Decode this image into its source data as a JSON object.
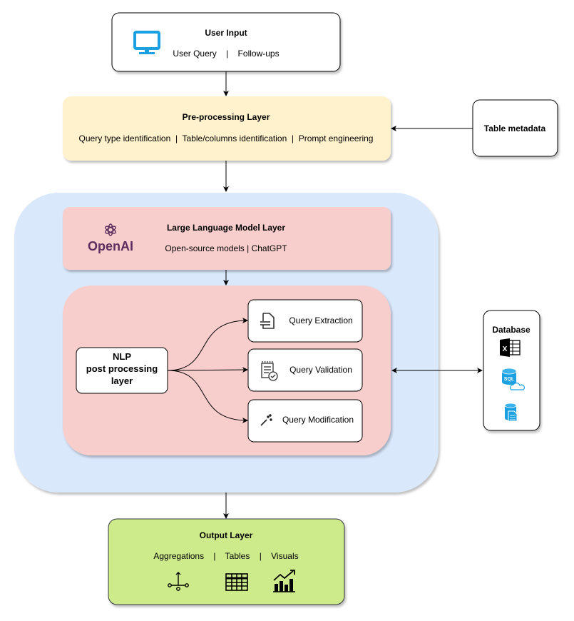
{
  "user_input": {
    "title": "User Input",
    "items": "User Query    |    Follow-ups",
    "icon": "monitor-icon"
  },
  "preprocessing": {
    "title": "Pre-processing Layer",
    "items": "Query type identification  |  Table/columns identification  |  Prompt engineering"
  },
  "table_metadata": {
    "title": "Table metadata"
  },
  "llm": {
    "title": "Large Language Model Layer",
    "items": "Open-source models  |  ChatGPT",
    "logo_text": "OpenAI"
  },
  "nlp": {
    "line1": "NLP",
    "line2": "post processing",
    "line3": "layer"
  },
  "query_steps": [
    {
      "label": "Query Extraction",
      "icon": "document-icon"
    },
    {
      "label": "Query Validation",
      "icon": "checklist-icon"
    },
    {
      "label": "Query Modification",
      "icon": "magic-wand-icon"
    }
  ],
  "database": {
    "title": "Database",
    "icons": [
      "excel-icon",
      "sql-cloud-icon",
      "database-file-icon"
    ]
  },
  "output": {
    "title": "Output Layer",
    "items": "Aggregations    |    Tables    |    Visuals",
    "icons": [
      "aggregation-icon",
      "table-icon",
      "chart-icon"
    ]
  },
  "colors": {
    "preprocessing": "#fff2cc",
    "container": "#dae8fc",
    "llm": "#f8cecc",
    "output": "#cdeb8b",
    "icon_blue": "#1ba1e2",
    "openai": "#5c2d5e"
  }
}
